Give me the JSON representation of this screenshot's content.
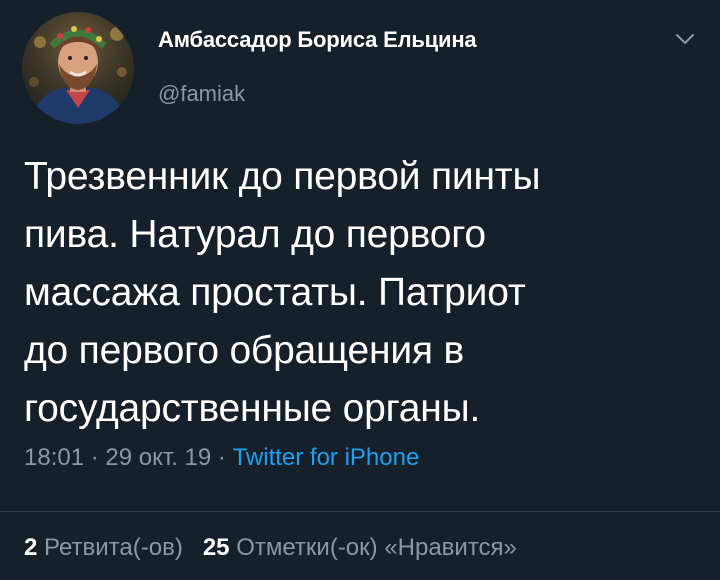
{
  "colors": {
    "background": "#15202b",
    "text_primary": "#ffffff",
    "text_secondary": "#8899a6",
    "link": "#1da1f2",
    "divider": "#38444d"
  },
  "author": {
    "display_name": "Амбассадор Бориса Ельцина",
    "handle": "@famiak",
    "avatar_icon": "user-avatar-photo"
  },
  "menu_icon": "chevron-down-icon",
  "tweet": {
    "text": "Трезвенник до первой пинты\nпива. Натурал до первого\nмассажа простаты. Патриот\nдо первого обращения в\nгосударственные органы.",
    "time": "18:01",
    "separator": " · ",
    "date": "29 окт. 19",
    "source": "Twitter for iPhone"
  },
  "stats": {
    "retweets_count": "2",
    "retweets_label": "Ретвита(-ов)",
    "likes_count": "25",
    "likes_label": "Отметки(-ок) «Нравится»"
  }
}
